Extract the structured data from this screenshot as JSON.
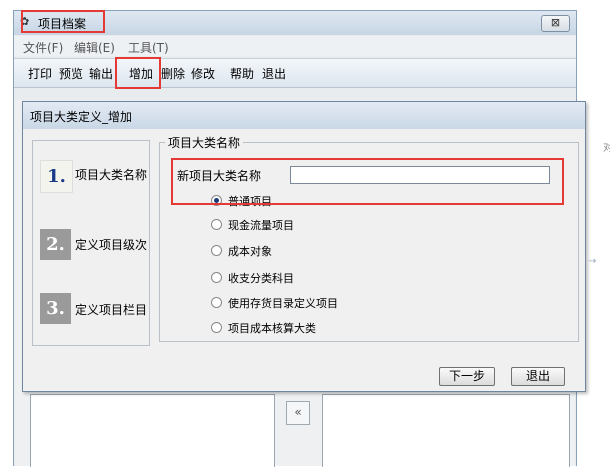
{
  "main_window": {
    "title": "项目档案",
    "close_glyph": "⊠",
    "title_icon": "gear-icon"
  },
  "menubar": {
    "items": [
      "文件(F)",
      "编辑(E)",
      "工具(T)"
    ]
  },
  "toolbar": {
    "print": "打印",
    "preview": "预览",
    "export": "输出",
    "add": "增加",
    "delete": "删除",
    "modify": "修改",
    "help": "帮助",
    "exit": "退出"
  },
  "transfer": {
    "move_left": "«"
  },
  "dialog": {
    "title": "项目大类定义_增加",
    "steps": [
      {
        "number": "1.",
        "label": "项目大类名称",
        "active": true
      },
      {
        "number": "2.",
        "label": "定义项目级次",
        "active": false
      },
      {
        "number": "3.",
        "label": "定义项目栏目",
        "active": false
      }
    ],
    "group_title": "项目大类名称",
    "name_label": "新项目大类名称",
    "name_value": "",
    "radio_options": [
      {
        "label": "普通项目",
        "checked": true
      },
      {
        "label": "现金流量项目",
        "checked": false
      },
      {
        "label": "成本对象",
        "checked": false
      },
      {
        "label": "收支分类科目",
        "checked": false
      },
      {
        "label": "使用存货目录定义项目",
        "checked": false
      },
      {
        "label": "项目成本核算大类",
        "checked": false
      }
    ],
    "next_button": "下一步",
    "exit_button": "退出"
  },
  "highlight_color": "#e53935",
  "outside_text": "对"
}
